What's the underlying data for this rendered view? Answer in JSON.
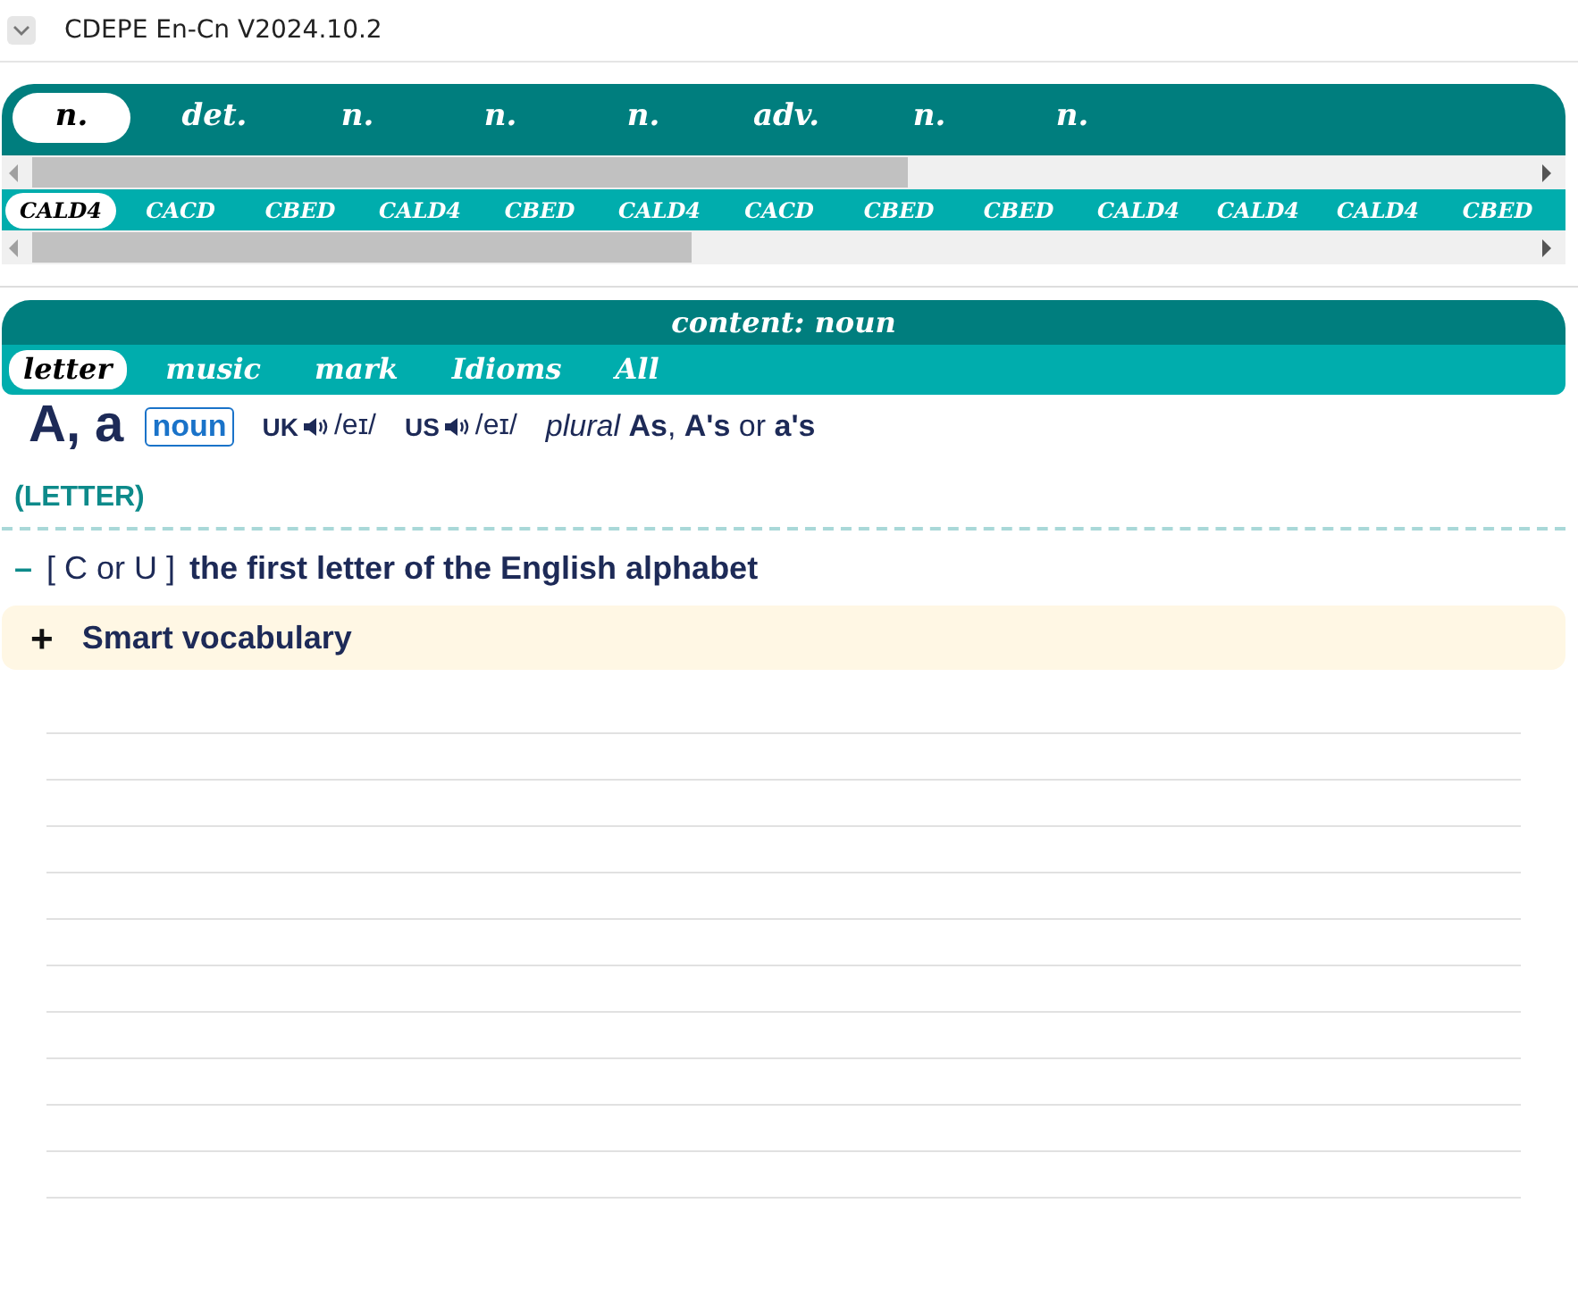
{
  "header": {
    "title": "CDEPE En-Cn V2024.10.2",
    "expanded": false
  },
  "pos_tabs": [
    {
      "label": "n.",
      "selected": true
    },
    {
      "label": "det.",
      "selected": false
    },
    {
      "label": "n.",
      "selected": false
    },
    {
      "label": "n.",
      "selected": false
    },
    {
      "label": "n.",
      "selected": false
    },
    {
      "label": "adv.",
      "selected": false
    },
    {
      "label": "n.",
      "selected": false
    },
    {
      "label": "n.",
      "selected": false
    }
  ],
  "source_tabs": [
    {
      "label": "CALD4",
      "selected": true
    },
    {
      "label": "CACD",
      "selected": false
    },
    {
      "label": "CBED",
      "selected": false
    },
    {
      "label": "CALD4",
      "selected": false
    },
    {
      "label": "CBED",
      "selected": false
    },
    {
      "label": "CALD4",
      "selected": false
    },
    {
      "label": "CACD",
      "selected": false
    },
    {
      "label": "CBED",
      "selected": false
    },
    {
      "label": "CBED",
      "selected": false
    },
    {
      "label": "CALD4",
      "selected": false
    },
    {
      "label": "CALD4",
      "selected": false
    },
    {
      "label": "CALD4",
      "selected": false
    },
    {
      "label": "CBED",
      "selected": false
    }
  ],
  "content": {
    "title": "content: noun",
    "sense_tabs": [
      {
        "label": "letter",
        "selected": true
      },
      {
        "label": "music",
        "selected": false
      },
      {
        "label": "mark",
        "selected": false
      },
      {
        "label": "Idioms",
        "selected": false
      },
      {
        "label": "All",
        "selected": false
      }
    ],
    "headword": "A, a",
    "pos": "noun",
    "pronunciations": [
      {
        "region": "UK",
        "ipa": "/eɪ/"
      },
      {
        "region": "US",
        "ipa": "/eɪ/"
      }
    ],
    "plural": "*plural* **As**, **A's** or **a's**",
    "guideword": "(LETTER)",
    "sense": {
      "toggle": "–",
      "grammar": "[ C or U ]",
      "definition": "the first letter of the English alphabet"
    },
    "smart_vocabulary": {
      "toggle": "+",
      "label": "Smart vocabulary",
      "expanded": false
    }
  }
}
